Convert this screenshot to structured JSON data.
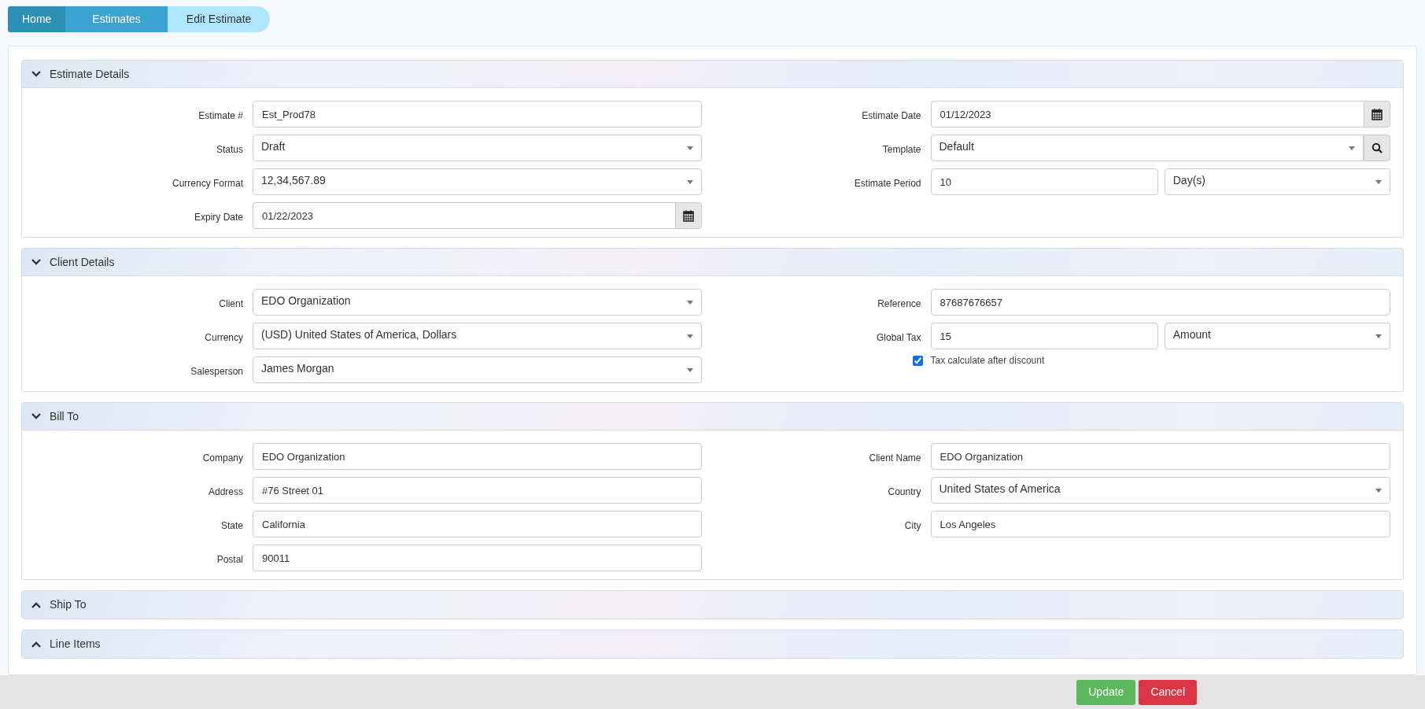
{
  "breadcrumb": [
    {
      "label": "Home",
      "selected": false
    },
    {
      "label": "Estimates",
      "selected": false
    },
    {
      "label": "Edit Estimate",
      "selected": true
    }
  ],
  "sections": [
    {
      "title": "Estimate Details",
      "expanded": true,
      "left": [
        {
          "kind": "text",
          "label": "Estimate #",
          "value": "Est_Prod78"
        },
        {
          "kind": "select",
          "label": "Status",
          "value": "Draft"
        },
        {
          "kind": "select",
          "label": "Currency Format",
          "value": "12,34,567.89"
        },
        {
          "kind": "date",
          "label": "Expiry Date",
          "value": "01/22/2023"
        }
      ],
      "right": [
        {
          "kind": "date",
          "label": "Estimate Date",
          "value": "01/12/2023"
        },
        {
          "kind": "select_search",
          "label": "Template",
          "value": "Default"
        },
        {
          "kind": "text_select",
          "label": "Estimate Period",
          "value": "10",
          "option": "Day(s)"
        }
      ]
    },
    {
      "title": "Client Details",
      "expanded": true,
      "left": [
        {
          "kind": "select",
          "label": "Client",
          "value": "EDO Organization"
        },
        {
          "kind": "select",
          "label": "Currency",
          "value": "(USD) United States of America, Dollars"
        },
        {
          "kind": "select",
          "label": "Salesperson",
          "value": "James Morgan"
        }
      ],
      "right": [
        {
          "kind": "text",
          "label": "Reference",
          "value": "87687676657"
        },
        {
          "kind": "text_select",
          "label": "Global Tax",
          "value": "15",
          "option": "Amount"
        },
        {
          "kind": "checkbox",
          "label": "Tax calculate after discount",
          "checked": true
        }
      ]
    },
    {
      "title": "Bill To",
      "expanded": true,
      "left": [
        {
          "kind": "text",
          "label": "Company",
          "value": "EDO Organization"
        },
        {
          "kind": "text",
          "label": "Address",
          "value": "#76 Street 01"
        },
        {
          "kind": "text",
          "label": "State",
          "value": "California"
        },
        {
          "kind": "text",
          "label": "Postal",
          "value": "90011"
        }
      ],
      "right": [
        {
          "kind": "text",
          "label": "Client Name",
          "value": "EDO Organization"
        },
        {
          "kind": "select",
          "label": "Country",
          "value": "United States of America"
        },
        {
          "kind": "text",
          "label": "City",
          "value": "Los Angeles"
        }
      ]
    },
    {
      "title": "Ship To",
      "expanded": false
    },
    {
      "title": "Line Items",
      "expanded": false
    }
  ],
  "buttons": [
    {
      "kind": "primary",
      "label": "Update"
    },
    {
      "kind": "danger",
      "label": "Cancel"
    }
  ]
}
